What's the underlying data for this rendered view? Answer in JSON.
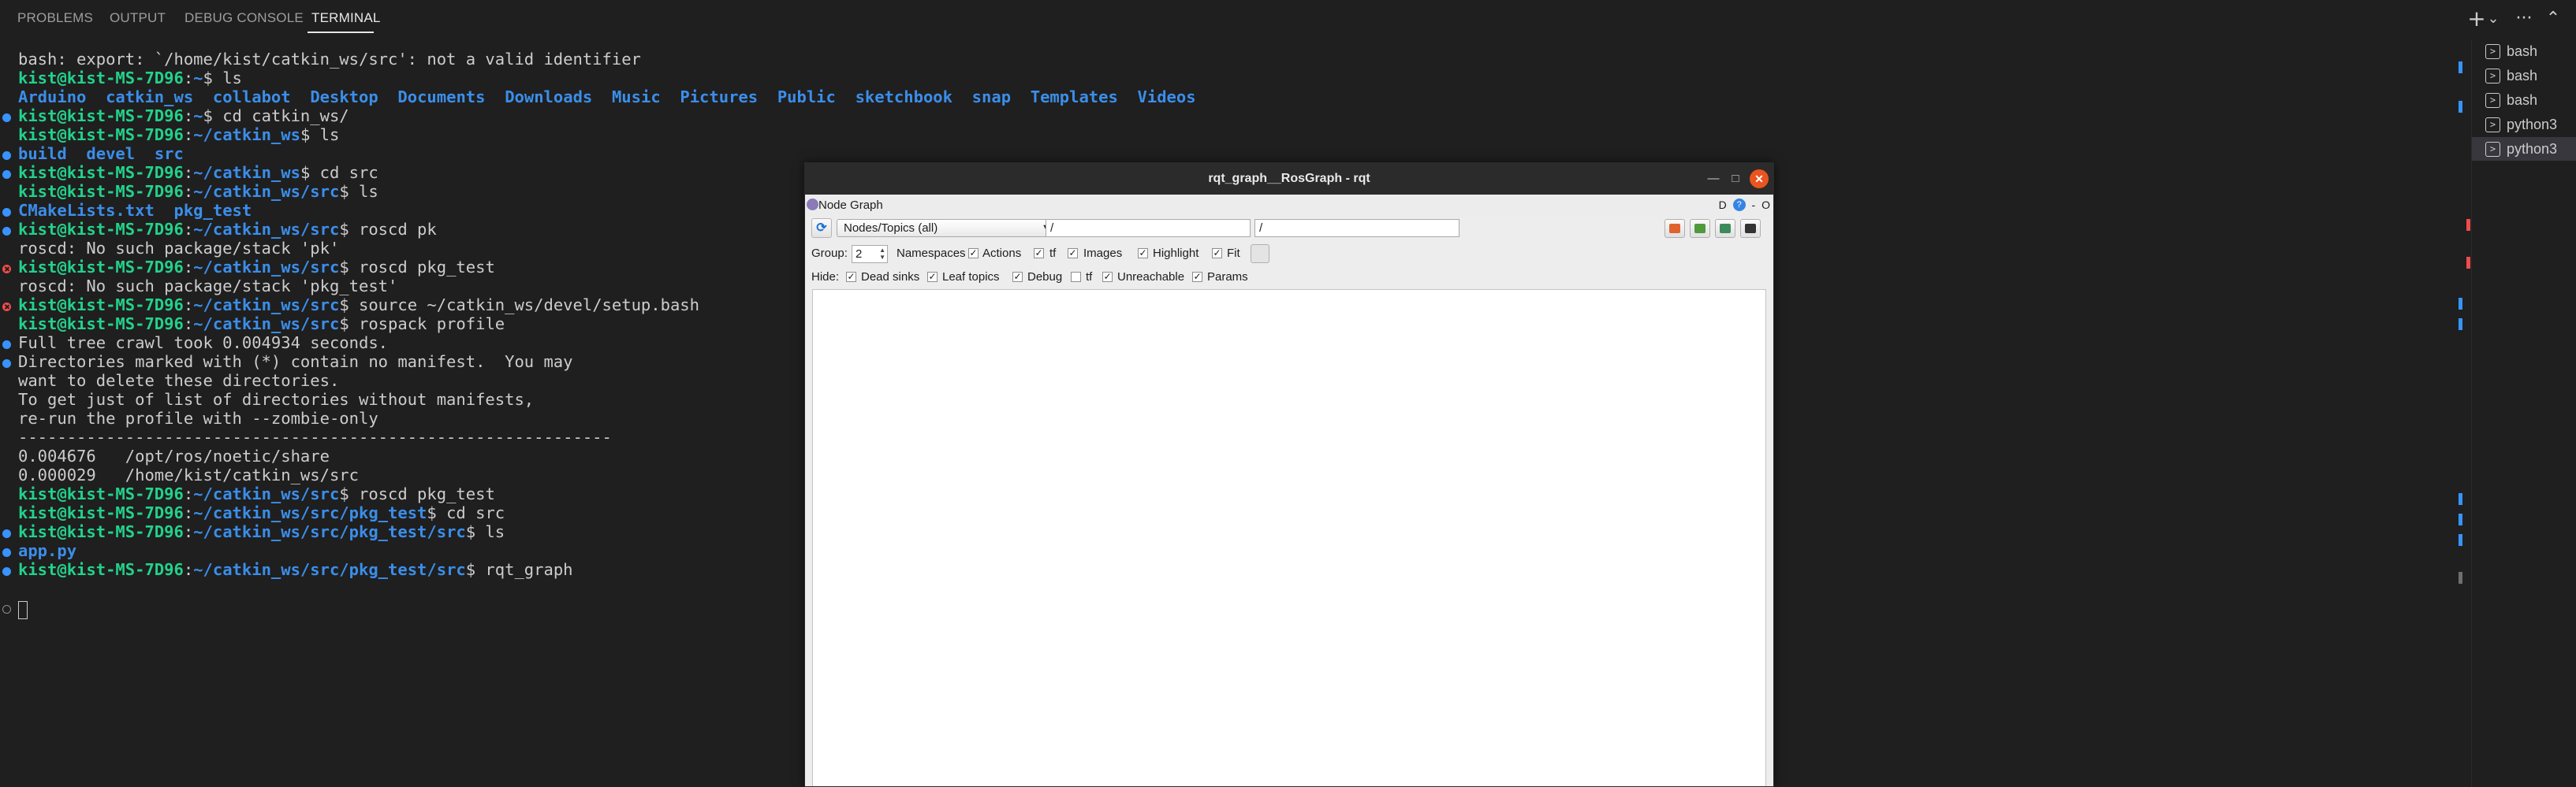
{
  "panel": {
    "tabs": [
      {
        "label": "PROBLEMS"
      },
      {
        "label": "OUTPUT"
      },
      {
        "label": "DEBUG CONSOLE"
      },
      {
        "label": "TERMINAL"
      }
    ],
    "active_tab": "TERMINAL",
    "actions": {
      "new_terminal": "+",
      "dropdown": "⌄",
      "more": "···",
      "collapse": "⌃"
    }
  },
  "terminal": {
    "colors": {
      "user": "#23d18b",
      "path": "#3b8eea",
      "text": "#cccccc",
      "ok_dot": "#3794ff",
      "err_dot": "#f14c4c"
    },
    "user": "kist@kist-MS-7D96",
    "lines": [
      {
        "text": "bash: export: `/home/kist/catkin_ws/src': not a valid identifier"
      },
      {
        "path": "~",
        "cmd": "ls"
      },
      {
        "dirs": [
          "Arduino",
          "catkin_ws",
          "collabot",
          "Desktop",
          "Documents",
          "Downloads",
          "Music",
          "Pictures",
          "Public",
          "sketchbook",
          "snap",
          "Templates",
          "Videos"
        ]
      },
      {
        "path": "~",
        "cmd": "cd catkin_ws/"
      },
      {
        "path": "~/catkin_ws",
        "cmd": "ls"
      },
      {
        "dirs": [
          "build",
          "devel",
          "src"
        ]
      },
      {
        "path": "~/catkin_ws",
        "cmd": "cd src"
      },
      {
        "path": "~/catkin_ws/src",
        "cmd": "ls"
      },
      {
        "dirs": [
          "CMakeLists.txt",
          "pkg_test"
        ]
      },
      {
        "path": "~/catkin_ws/src",
        "cmd": "roscd pk"
      },
      {
        "text": "roscd: No such package/stack 'pk'"
      },
      {
        "path": "~/catkin_ws/src",
        "cmd": "roscd pkg_test"
      },
      {
        "text": "roscd: No such package/stack 'pkg_test'"
      },
      {
        "path": "~/catkin_ws/src",
        "cmd": "source ~/catkin_ws/devel/setup.bash"
      },
      {
        "path": "~/catkin_ws/src",
        "cmd": "rospack profile"
      },
      {
        "text": "Full tree crawl took 0.004934 seconds."
      },
      {
        "text": "Directories marked with (*) contain no manifest.  You may"
      },
      {
        "text": "want to delete these directories."
      },
      {
        "text": "To get just of list of directories without manifests,"
      },
      {
        "text": "re-run the profile with --zombie-only"
      },
      {
        "text": "-------------------------------------------------------------"
      },
      {
        "text": "0.004676   /opt/ros/noetic/share"
      },
      {
        "text": "0.000029   /home/kist/catkin_ws/src"
      },
      {
        "path": "~/catkin_ws/src",
        "cmd": "roscd pkg_test"
      },
      {
        "path": "~/catkin_ws/src/pkg_test",
        "cmd": "cd src"
      },
      {
        "path": "~/catkin_ws/src/pkg_test/src",
        "cmd": "ls"
      },
      {
        "dirs": [
          "app.py"
        ]
      },
      {
        "path": "~/catkin_ws/src/pkg_test/src",
        "cmd": "rqt_graph"
      }
    ]
  },
  "side_terminals": [
    {
      "label": "bash"
    },
    {
      "label": "bash"
    },
    {
      "label": "bash"
    },
    {
      "label": "python3"
    },
    {
      "label": "python3",
      "active": true
    }
  ],
  "rqt": {
    "title": "rqt_graph__RosGraph - rqt",
    "plugin_title": "Node Graph",
    "plugin_buttons": [
      "D",
      "?",
      "-",
      "O"
    ],
    "mode_select": "Nodes/Topics (all)",
    "filter1": "/",
    "filter2": "/",
    "group_label": "Group:",
    "group_value": "2",
    "hide_label": "Hide:",
    "row2_options": [
      {
        "label": "Namespaces",
        "checked": true
      },
      {
        "label": "Actions",
        "checked": true
      },
      {
        "label": "tf",
        "checked": true
      },
      {
        "label": "Images",
        "checked": true
      },
      {
        "label": "Highlight",
        "checked": true
      },
      {
        "label": "Fit",
        "checked": true
      }
    ],
    "row3_options": [
      {
        "label": "Dead sinks",
        "checked": true
      },
      {
        "label": "Leaf topics",
        "checked": true
      },
      {
        "label": "Debug",
        "checked": true
      },
      {
        "label": "tf",
        "checked": false
      },
      {
        "label": "Unreachable",
        "checked": true
      },
      {
        "label": "Params",
        "checked": true
      }
    ],
    "colors": {
      "titlebar": "#2b2b2b",
      "close": "#e95420",
      "body": "#ededed"
    }
  }
}
